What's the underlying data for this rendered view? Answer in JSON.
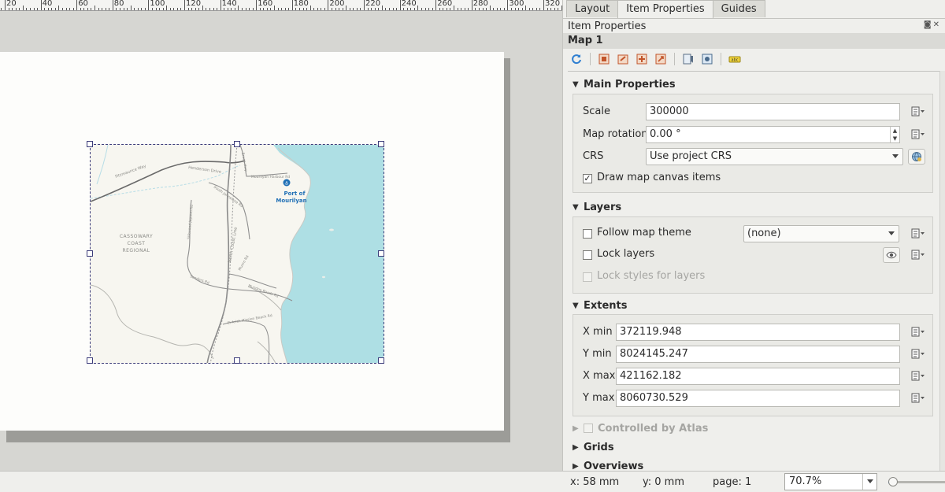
{
  "ruler": {
    "labels": [
      "20",
      "40",
      "60",
      "80",
      "100",
      "120",
      "140",
      "160",
      "180",
      "200",
      "220",
      "240",
      "260",
      "280",
      "300",
      "320"
    ]
  },
  "map": {
    "place_port": "Port of",
    "place_port2": "Mourilyan",
    "region_line1": "CASSOWARY",
    "region_line2": "COAST",
    "region_line3": "REGIONAL",
    "road_1": "Fitzmaurice Way",
    "road_2": "Henderson Drive",
    "road_3": "Mourilyan Harbour Rd",
    "road_4": "South Johnstone Rd",
    "road_5": "North Coast Line",
    "road_6": "Silkwood Japoon Rd",
    "road_7": "Munro Rd",
    "road_8": "Mundoo Roads Rd",
    "road_9": "El Arish Mission Beach Rd",
    "road_10": "Bruce Hwy",
    "road_11": "Sanders Rd",
    "colors": {
      "water": "#aedfe4",
      "land": "#f7f6f0",
      "road": "#8e8e8e",
      "port": "#1f6fb5"
    }
  },
  "dock": {
    "tabs": [
      "Layout",
      "Item Properties",
      "Guides"
    ],
    "active_tab": "Item Properties",
    "title": "Item Properties",
    "title_buttons": "◙✕",
    "item_name": "Map 1",
    "toolbar_icons": [
      "refresh-icon",
      "set-extent-icon",
      "view-extent-icon",
      "set-scale-icon",
      "view-scale-icon",
      "bookmark-icon",
      "label-settings-icon",
      "label-icon"
    ]
  },
  "main_properties": {
    "header": "Main Properties",
    "scale_label": "Scale",
    "scale_value": "300000",
    "rotation_label": "Map rotation",
    "rotation_value": "0.00 °",
    "crs_label": "CRS",
    "crs_value": "Use project CRS",
    "draw_items_label": "Draw map canvas items",
    "draw_items_checked": "✓"
  },
  "layers": {
    "header": "Layers",
    "follow_theme_label": "Follow map theme",
    "theme_value": "(none)",
    "lock_layers_label": "Lock layers",
    "lock_styles_label": "Lock styles for layers"
  },
  "extents": {
    "header": "Extents",
    "xmin_label": "X min",
    "xmin_value": "372119.948",
    "ymin_label": "Y min",
    "ymin_value": "8024145.247",
    "xmax_label": "X max",
    "xmax_value": "421162.182",
    "ymax_label": "Y max",
    "ymax_value": "8060730.529"
  },
  "collapsed_sections": {
    "atlas": "Controlled by Atlas",
    "grids": "Grids",
    "overviews": "Overviews"
  },
  "status": {
    "x": "x: 58 mm",
    "y": "y: 0 mm",
    "page": "page: 1",
    "zoom": "70.7%",
    "zoom_slider_fraction": 0.08
  }
}
